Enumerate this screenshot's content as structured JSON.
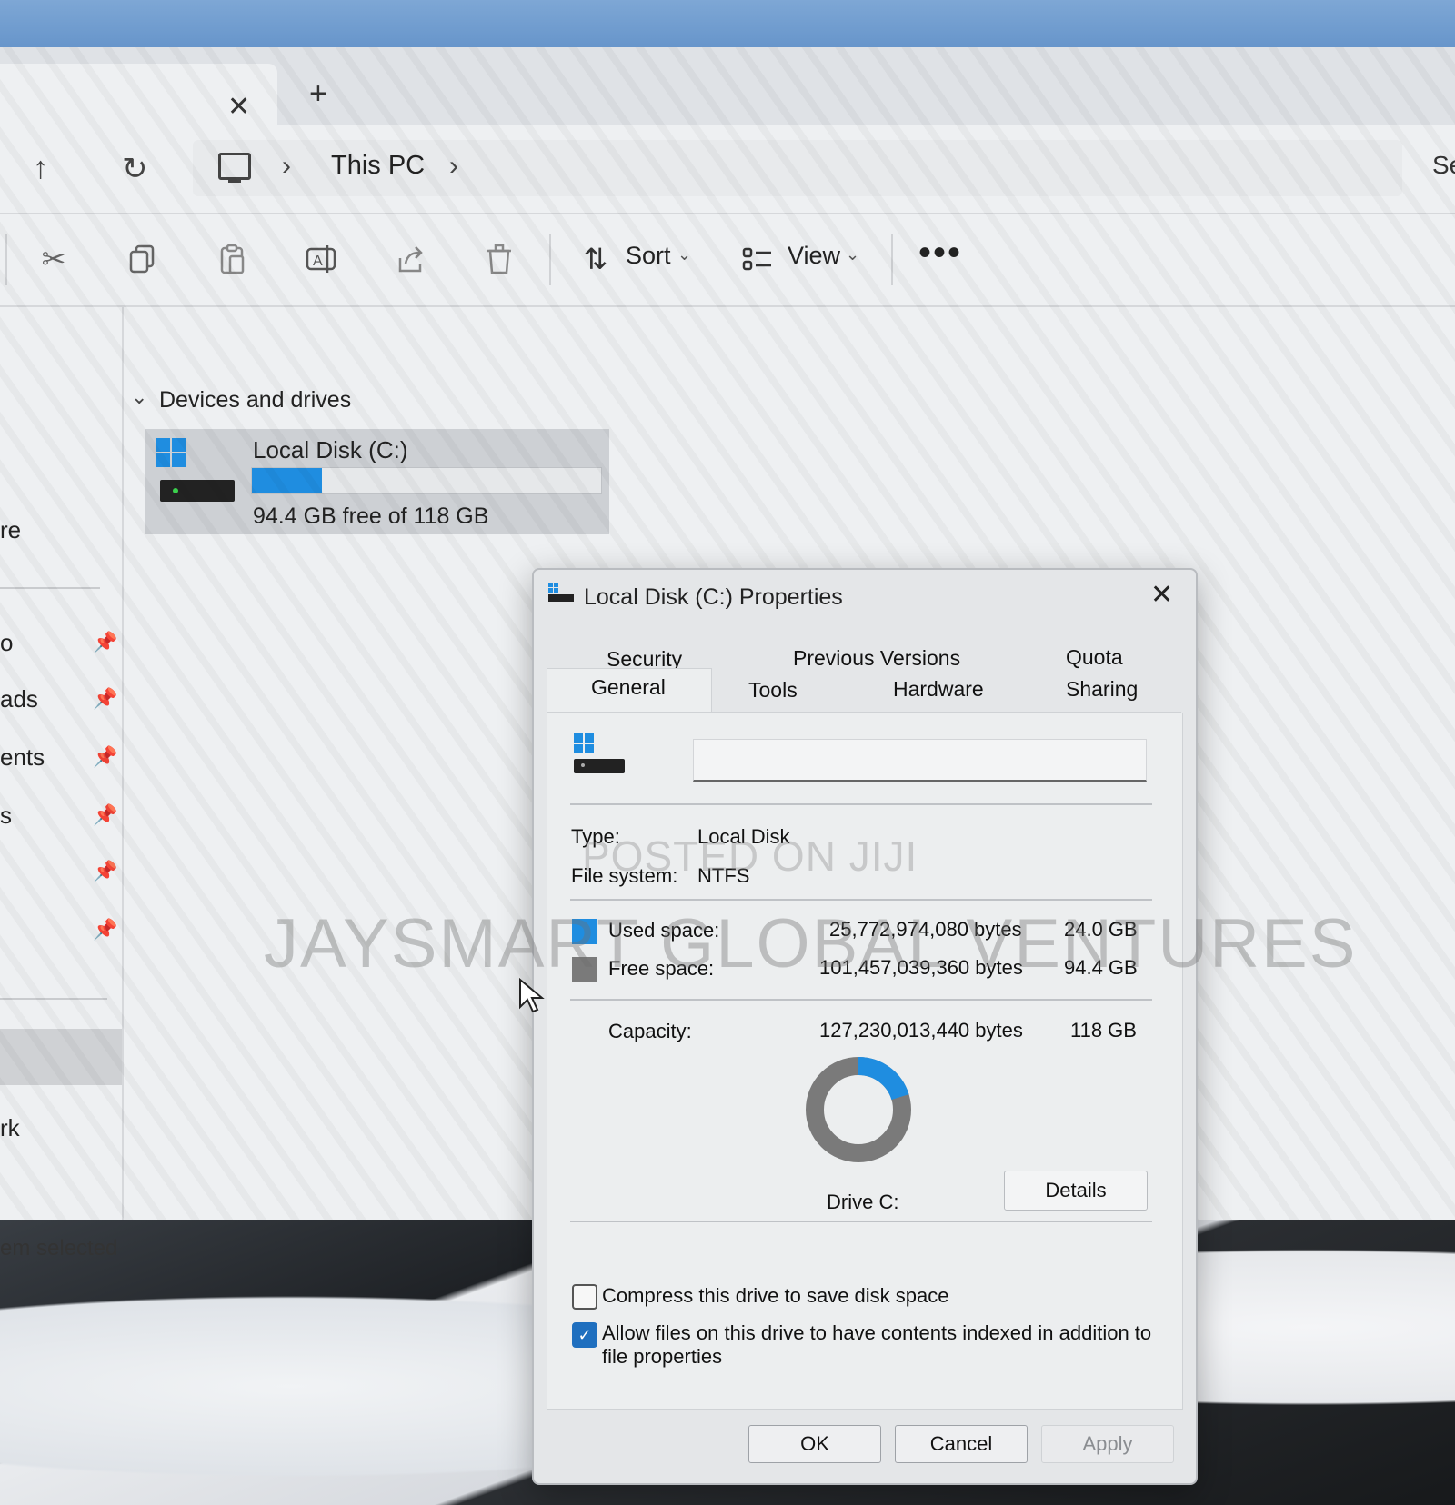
{
  "explorer": {
    "new_tab_label": "+",
    "breadcrumb": {
      "location": "This PC"
    },
    "search_stub": "Se",
    "toolbar": {
      "sort_label": "Sort",
      "view_label": "View",
      "more_label": "•••"
    },
    "nav_pane": {
      "items": [
        {
          "label": "re"
        },
        {
          "label": "o"
        },
        {
          "label": "ads"
        },
        {
          "label": "ents"
        },
        {
          "label": "s"
        },
        {
          "label": ""
        },
        {
          "label": ""
        },
        {
          "label": "rk"
        }
      ]
    },
    "section_label": "Devices and drives",
    "drive": {
      "name": "Local Disk (C:)",
      "free_text": "94.4 GB free of 118 GB",
      "used_fraction": 0.2
    },
    "status_text": "em selected"
  },
  "dialog": {
    "title": "Local Disk (C:) Properties",
    "tabs_row1": [
      "Security",
      "Previous Versions",
      "Quota"
    ],
    "tabs_row2": [
      "General",
      "Tools",
      "Hardware",
      "Sharing"
    ],
    "active_tab": "General",
    "volume_label_value": "",
    "type_label": "Type:",
    "type_value": "Local Disk",
    "fs_label": "File system:",
    "fs_value": "NTFS",
    "used_label": "Used space:",
    "used_bytes": "25,772,974,080 bytes",
    "used_gb": "24.0 GB",
    "free_label": "Free space:",
    "free_bytes": "101,457,039,360 bytes",
    "free_gb": "94.4 GB",
    "capacity_label": "Capacity:",
    "capacity_bytes": "127,230,013,440 bytes",
    "capacity_gb": "118 GB",
    "drive_label": "Drive C:",
    "details_label": "Details",
    "compress_label": "Compress this drive to save disk space",
    "compress_checked": false,
    "index_label_line1": "Allow files on this drive to have contents indexed in addition to",
    "index_label_line2": "file properties",
    "index_checked": true,
    "ok_label": "OK",
    "cancel_label": "Cancel",
    "apply_label": "Apply",
    "used_fraction": 0.2026
  },
  "colors": {
    "used": "#1f8de0",
    "free": "#7a7a7a",
    "accent": "#1f6fbf"
  },
  "watermarks": {
    "small": "POSTED ON JIJI",
    "big": "JAYSMART GLOBAL VENTURES"
  }
}
